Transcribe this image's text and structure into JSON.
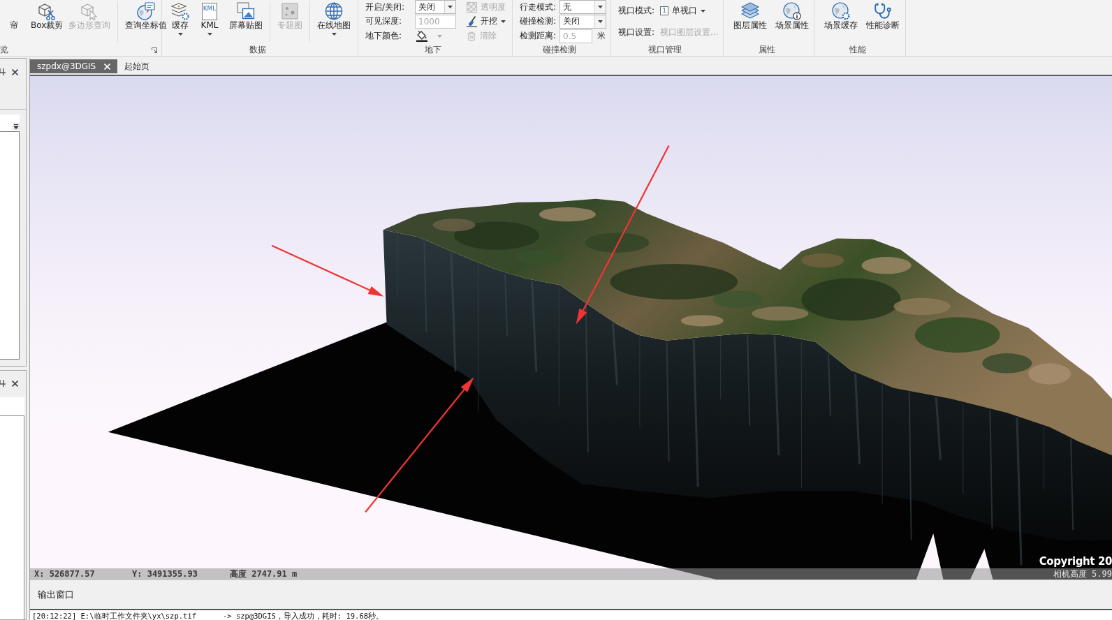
{
  "ribbon": {
    "groups": [
      {
        "label": "览",
        "launcher": true,
        "items": [
          {
            "kind": "large",
            "label": "帘",
            "disabled": false,
            "dropdown": false
          },
          {
            "kind": "large",
            "label": "Box裁剪",
            "disabled": false,
            "dropdown": false
          },
          {
            "kind": "large",
            "label": "多边形查询",
            "disabled": true,
            "dropdown": false
          },
          {
            "kind": "separator"
          },
          {
            "kind": "large",
            "label": "查询坐标值",
            "disabled": false,
            "dropdown": false
          }
        ]
      },
      {
        "label": "数据",
        "items": [
          {
            "kind": "large",
            "label": "缓存",
            "disabled": false,
            "dropdown": true
          },
          {
            "kind": "large",
            "label": "KML",
            "icon_text": "KML",
            "disabled": false,
            "dropdown": true
          },
          {
            "kind": "large",
            "label": "屏幕贴图",
            "disabled": false,
            "dropdown": false
          },
          {
            "kind": "separator"
          },
          {
            "kind": "large",
            "label": "专题图",
            "disabled": true,
            "dropdown": false
          },
          {
            "kind": "separator"
          },
          {
            "kind": "large",
            "label": "在线地图",
            "disabled": false,
            "dropdown": true
          }
        ]
      },
      {
        "label": "地下",
        "items": [
          {
            "kind": "fields",
            "rows": [
              {
                "label": "开启/关闭:",
                "control": {
                  "kind": "combo",
                  "value": "关闭",
                  "disabled": false
                }
              },
              {
                "label": "可见深度:",
                "control": {
                  "kind": "input",
                  "value": "1000",
                  "disabled": true
                }
              },
              {
                "label": "地下颜色:",
                "control": {
                  "kind": "color",
                  "disabled": false
                }
              }
            ]
          },
          {
            "kind": "small",
            "buttons": [
              {
                "label": "透明度",
                "disabled": true,
                "dropdown": false
              },
              {
                "label": "开挖",
                "disabled": false,
                "dropdown": true
              },
              {
                "label": "清除",
                "disabled": true,
                "dropdown": false
              }
            ]
          }
        ]
      },
      {
        "label": "碰撞检测",
        "items": [
          {
            "kind": "fields",
            "rows": [
              {
                "label": "行走模式:",
                "control": {
                  "kind": "combo",
                  "value": "无",
                  "disabled": false
                }
              },
              {
                "label": "碰撞检测:",
                "control": {
                  "kind": "combo",
                  "value": "关闭",
                  "disabled": false
                }
              },
              {
                "label": "检测距离:",
                "control": {
                  "kind": "input",
                  "value": "0.5",
                  "disabled": true,
                  "unit": "米"
                }
              }
            ]
          }
        ]
      },
      {
        "label": "视口管理",
        "items": [
          {
            "kind": "fields",
            "rows": [
              {
                "label": "视口模式:",
                "control": {
                  "kind": "menu",
                  "icon_text": "1",
                  "value": "单视口",
                  "disabled": false
                }
              },
              {
                "label": "视口设置:",
                "control": {
                  "kind": "link",
                  "value": "视口图层设置...",
                  "disabled": true
                }
              }
            ]
          }
        ]
      },
      {
        "label": "属性",
        "items": [
          {
            "kind": "large",
            "label": "图层属性",
            "disabled": false,
            "dropdown": false
          },
          {
            "kind": "large",
            "label": "场景属性",
            "disabled": false,
            "dropdown": false
          }
        ]
      },
      {
        "label": "性能",
        "items": [
          {
            "kind": "large",
            "label": "场景缓存",
            "disabled": false,
            "dropdown": false
          },
          {
            "kind": "large",
            "label": "性能诊断",
            "disabled": false,
            "dropdown": false
          }
        ]
      }
    ]
  },
  "document_tabs": [
    {
      "label": "szpdx@3DGIS",
      "selected": true,
      "closable": true
    },
    {
      "label": "起始页",
      "selected": false,
      "closable": false
    }
  ],
  "scene": {
    "copyright": "Copyright 20",
    "status_bar": {
      "x": "X: 526877.57",
      "y": "Y: 3491355.93",
      "altitude": "高度 2747.91 m",
      "camera_height": "相机高度 5.99"
    }
  },
  "output_window": {
    "title": "输出窗口",
    "lines": [
      "[20:12:22] E:\\临时工作文件夹\\yx\\szp.tif      -> szp@3DGIS，导入成功，耗时: 19.68秒。"
    ]
  }
}
